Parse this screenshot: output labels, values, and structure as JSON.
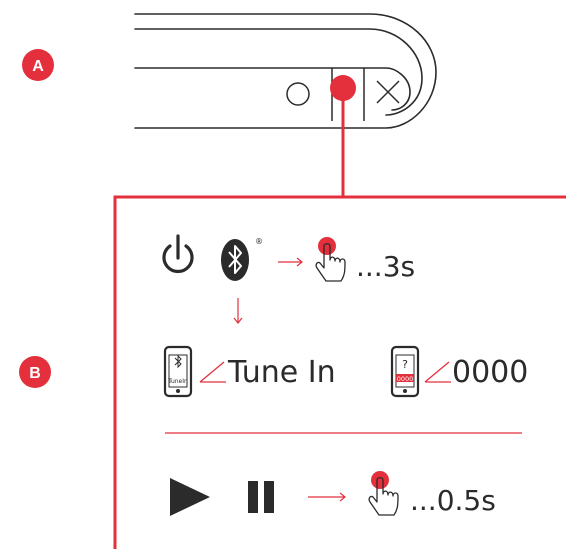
{
  "badges": {
    "a": "A",
    "b": "B"
  },
  "steps": {
    "hold_long": "...3s",
    "tune_in": "Tune In",
    "pin": "0000",
    "hold_short": "...0.5s"
  },
  "phone_labels": {
    "tunein_small": "TuneIn",
    "question": "?",
    "pin_small": "0000"
  },
  "symbols": {
    "bluetooth_mark": "®"
  },
  "colors": {
    "accent": "#e3303c",
    "ink": "#2b2b2b"
  }
}
